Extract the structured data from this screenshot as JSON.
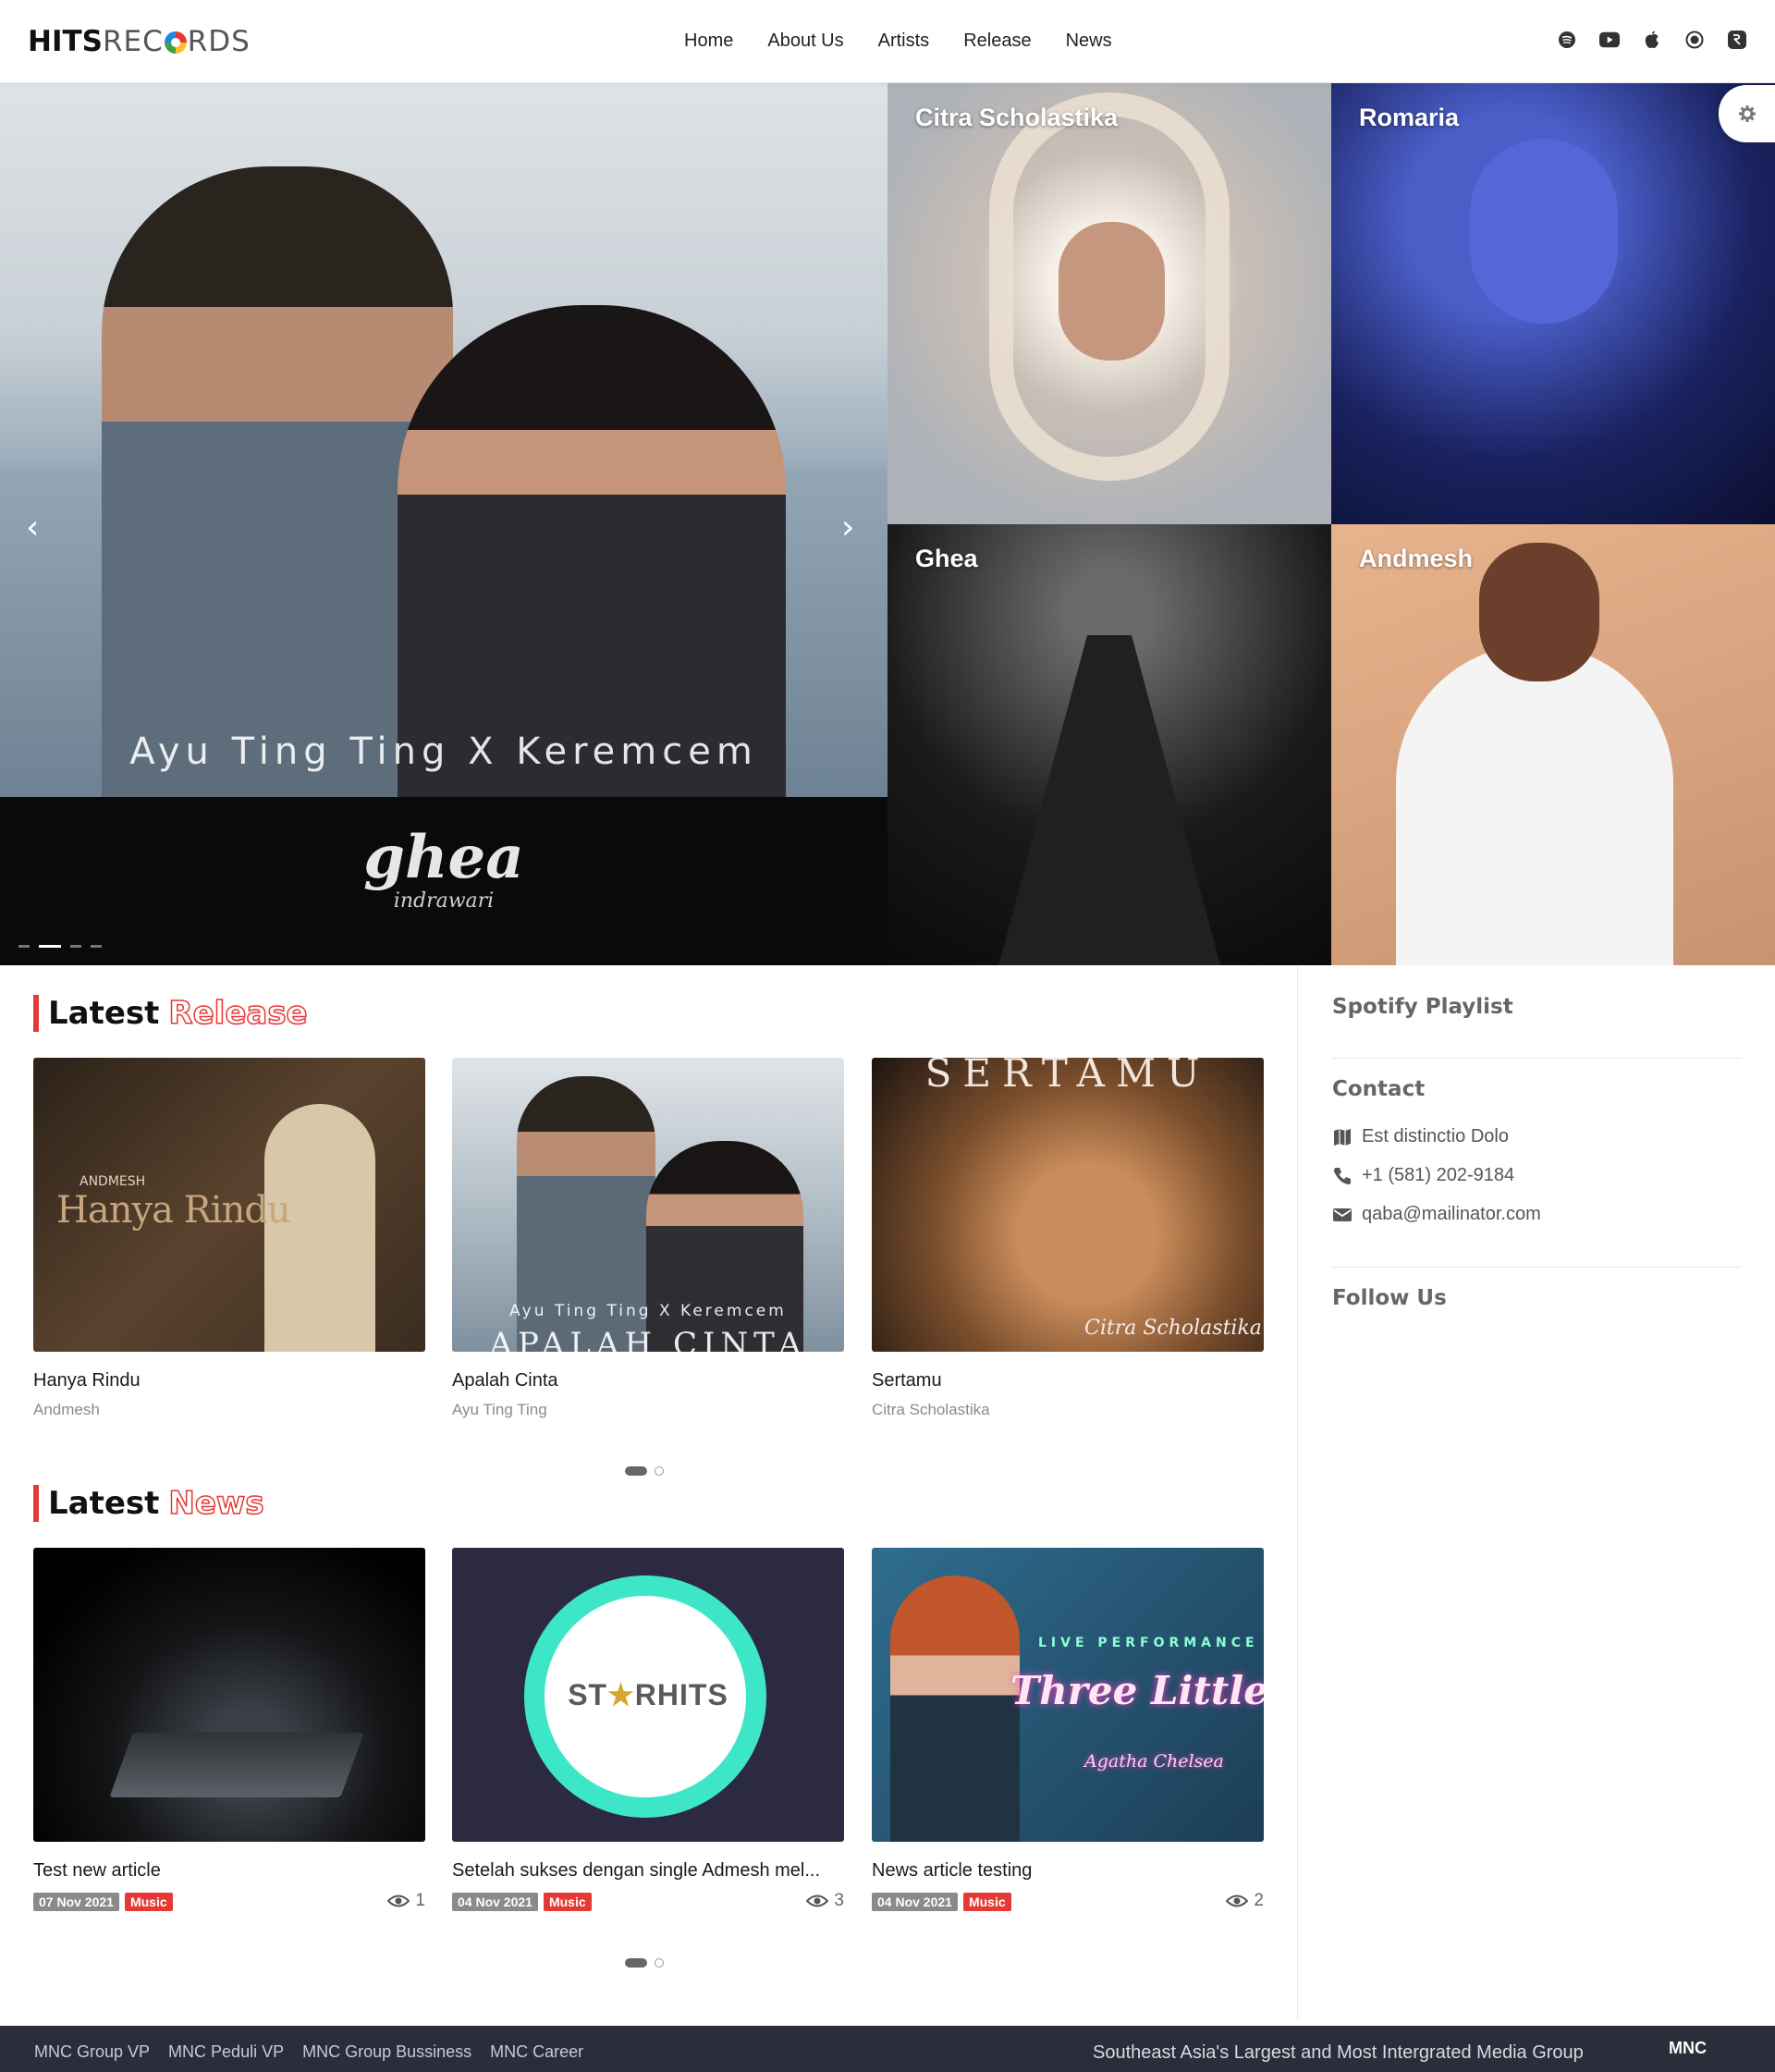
{
  "brand": {
    "logo_part1": "HITS",
    "logo_part2": "REC",
    "logo_part3": "RDS"
  },
  "nav": {
    "items": [
      {
        "label": "Home"
      },
      {
        "label": "About Us"
      },
      {
        "label": "Artists"
      },
      {
        "label": "Release"
      },
      {
        "label": "News"
      }
    ],
    "socials": [
      "spotify-icon",
      "youtube-icon",
      "apple-icon",
      "record-icon",
      "deezer-icon"
    ]
  },
  "hero": {
    "caption": "Ayu Ting Ting X Keremcem",
    "next_slide_script": "ghea",
    "next_slide_sub": "indrawari",
    "prev_arrow": "‹",
    "next_arrow": "›",
    "slides_count": 4,
    "active_slide": 2
  },
  "artists": [
    {
      "name": "Citra Scholastika"
    },
    {
      "name": "Romaria"
    },
    {
      "name": "Ghea"
    },
    {
      "name": "Andmesh"
    }
  ],
  "latest_release": {
    "heading_word1": "Latest",
    "heading_word2": "Release",
    "items": [
      {
        "title": "Hanya Rindu",
        "artist": "Andmesh",
        "cover_text": "Hanya Rindu",
        "cover_small": "ANDMESH"
      },
      {
        "title": "Apalah Cinta",
        "artist": "Ayu Ting Ting",
        "cover_text": "Ayu Ting Ting X Keremcem",
        "cover_big": "APALAH CINTA"
      },
      {
        "title": "Sertamu",
        "artist": "Citra Scholastika",
        "cover_text": "SERTAMU",
        "cover_sig": "Citra Scholastika"
      }
    ]
  },
  "latest_news": {
    "heading_word1": "Latest",
    "heading_word2": "News",
    "items": [
      {
        "title": "Test new article",
        "date": "07 Nov 2021",
        "category": "Music",
        "views": "1"
      },
      {
        "title": "Setelah sukses dengan single Admesh mel...",
        "date": "04 Nov 2021",
        "category": "Music",
        "views": "3",
        "cover_text_a": "ST",
        "cover_text_b": "★",
        "cover_text_c": "RHITS"
      },
      {
        "title": "News article testing",
        "date": "04 Nov 2021",
        "category": "Music",
        "views": "2",
        "cover_top": "LIVE PERFORMANCE",
        "cover_title": "Three Little Words",
        "cover_artist": "Agatha Chelsea"
      }
    ]
  },
  "sidebar": {
    "playlist_heading": "Spotify Playlist",
    "contact_heading": "Contact",
    "address": "Est distinctio Dolo",
    "phone": "+1 (581) 202-9184",
    "email": "qaba@mailinator.com",
    "follow_heading": "Follow Us"
  },
  "footer": {
    "links": [
      "MNC Group VP",
      "MNC Peduli VP",
      "MNC Group Bussiness",
      "MNC Career"
    ],
    "tagline": "Southeast Asia's Largest and Most Intergrated Media Group",
    "brand": "MNC"
  },
  "colors": {
    "accent": "#e53935",
    "footer_bg": "#2b2d3a"
  }
}
